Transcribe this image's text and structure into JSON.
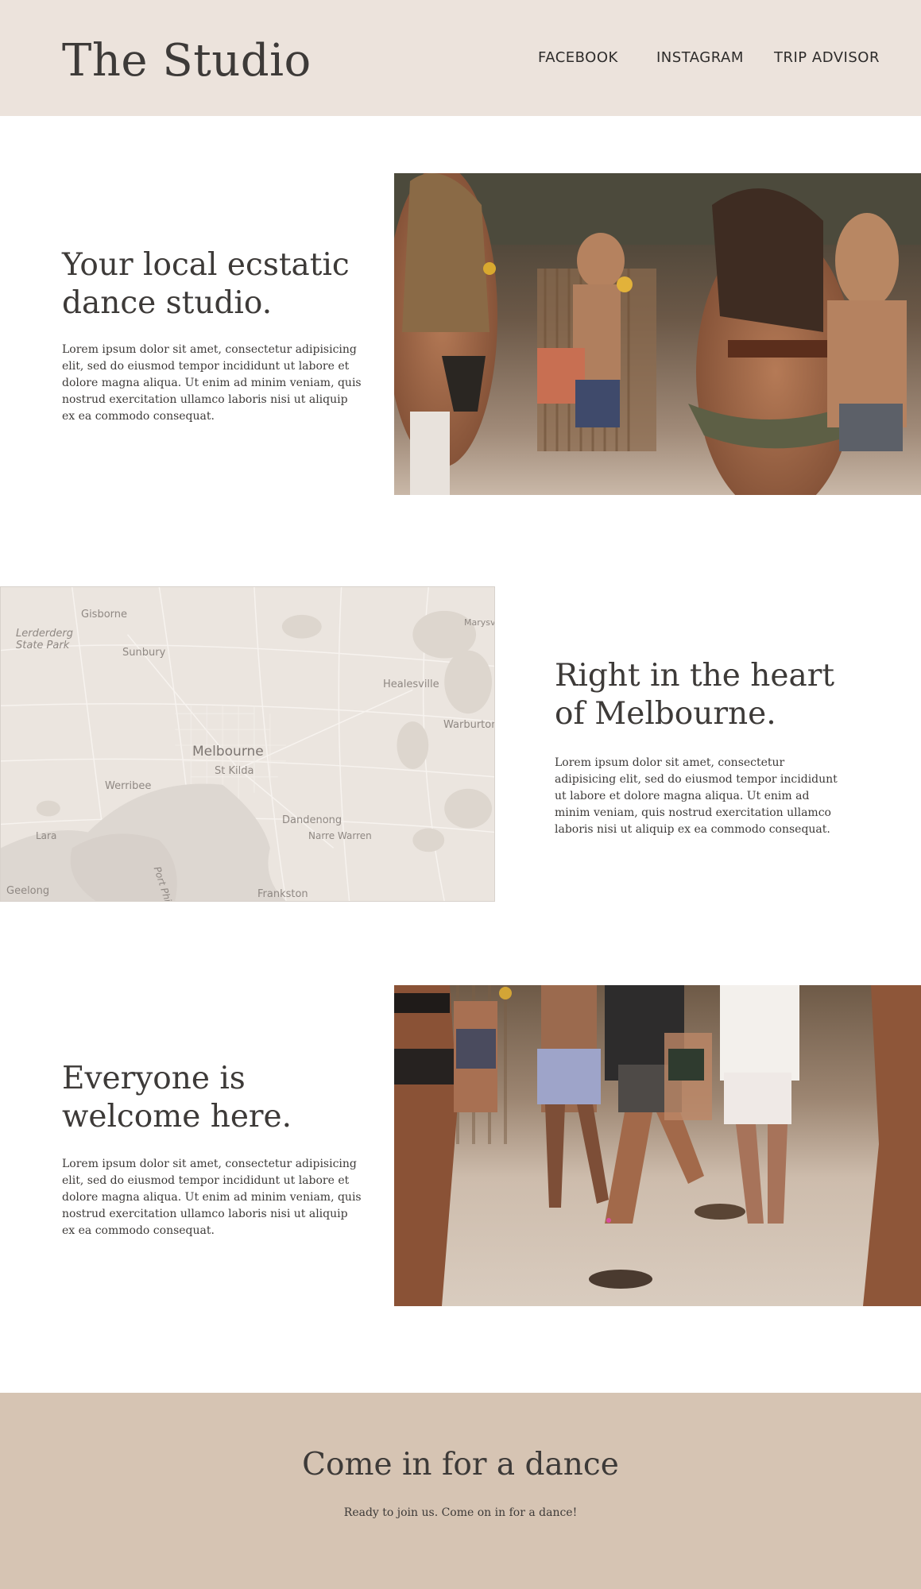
{
  "header": {
    "brand": "The Studio",
    "nav": {
      "facebook": "FACEBOOK",
      "instagram": "INSTAGRAM",
      "tripadvisor": "TRIP ADVISOR"
    }
  },
  "sections": [
    {
      "heading_line1": "Your local ecstatic",
      "heading_line2": "dance studio.",
      "body": "Lorem ipsum dolor sit amet, consectetur adipisicing elit, sed do eiusmod tempor incididunt ut labore et dolore magna aliqua. Ut enim ad minim veniam, quis nostrud exercitation ullamco laboris nisi ut aliquip ex ea commodo consequat."
    },
    {
      "heading_line1": "Right in the heart",
      "heading_line2": "of Melbourne.",
      "body": "Lorem ipsum dolor sit amet, consectetur adipisicing elit, sed do eiusmod tempor incididunt ut labore et dolore magna aliqua. Ut enim ad minim veniam, quis nostrud exercitation ullamco laboris nisi ut aliquip ex ea commodo consequat."
    },
    {
      "heading_line1": "Everyone is",
      "heading_line2": "welcome here.",
      "body": "Lorem ipsum dolor sit amet, consectetur adipisicing elit, sed do eiusmod tempor incididunt ut labore et dolore magna aliqua. Ut enim ad minim veniam, quis nostrud exercitation ullamco laboris nisi ut aliquip ex ea commodo consequat."
    }
  ],
  "map": {
    "labels": {
      "gisborne": "Gisborne",
      "lerderderg1": "Lerderderg",
      "lerderderg2": "State Park",
      "sunbury": "Sunbury",
      "marysville": "Marysv",
      "healesville": "Healesville",
      "warburton": "Warburton",
      "melbourne": "Melbourne",
      "stkilda": "St Kilda",
      "werribee": "Werribee",
      "dandenong": "Dandenong",
      "narrewarren": "Narre Warren",
      "lara": "Lara",
      "portphillip": "Port Phillip",
      "geelong": "Geelong",
      "frankston": "Frankston"
    }
  },
  "footer": {
    "title": "Come in for a dance",
    "subtitle": "Ready to join us. Come on in for a dance!"
  },
  "colors": {
    "header_bg": "#ece3dc",
    "footer_bg": "#d6c4b3",
    "text": "#3d3a38",
    "map_bg": "#ebe5df"
  }
}
